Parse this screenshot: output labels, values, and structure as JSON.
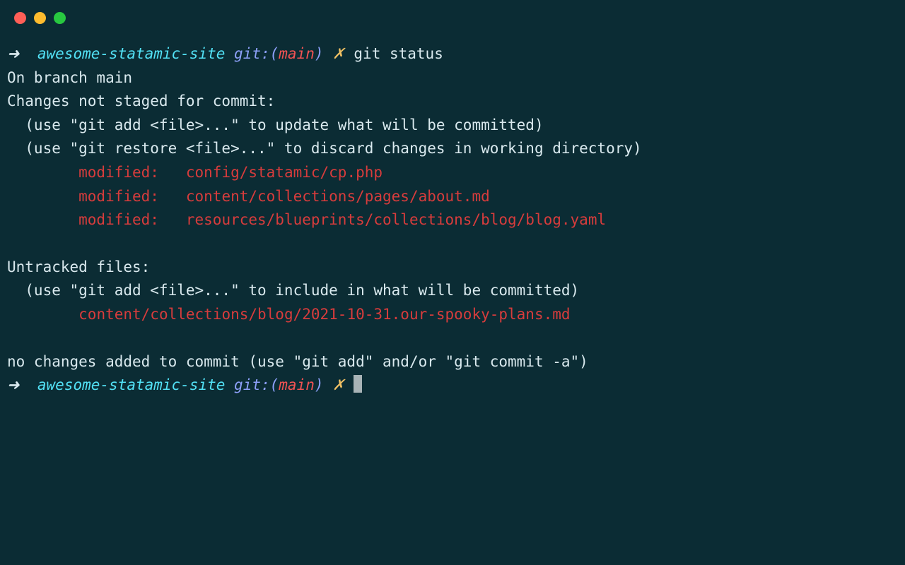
{
  "prompt1": {
    "arrow": "➜  ",
    "dir": "awesome-statamic-site",
    "git_label": " git:",
    "paren_open": "(",
    "branch": "main",
    "paren_close": ")",
    "dirty": " ✗",
    "command": " git status"
  },
  "output": {
    "l1": "On branch main",
    "l2": "Changes not staged for commit:",
    "l3": "  (use \"git add <file>...\" to update what will be committed)",
    "l4": "  (use \"git restore <file>...\" to discard changes in working directory)",
    "mod1_status": "        modified:   ",
    "mod1_file": "config/statamic/cp.php",
    "mod2_status": "        modified:   ",
    "mod2_file": "content/collections/pages/about.md",
    "mod3_status": "        modified:   ",
    "mod3_file": "resources/blueprints/collections/blog/blog.yaml",
    "l8": "Untracked files:",
    "l9": "  (use \"git add <file>...\" to include in what will be committed)",
    "untracked_indent": "        ",
    "untracked1": "content/collections/blog/2021-10-31.our-spooky-plans.md",
    "l11": "no changes added to commit (use \"git add\" and/or \"git commit -a\")"
  },
  "prompt2": {
    "arrow": "➜  ",
    "dir": "awesome-statamic-site",
    "git_label": " git:",
    "paren_open": "(",
    "branch": "main",
    "paren_close": ")",
    "dirty": " ✗ "
  }
}
